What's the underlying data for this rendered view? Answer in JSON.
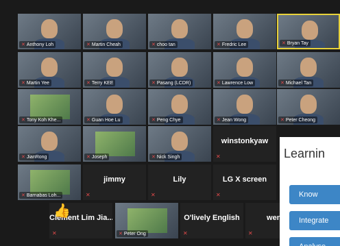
{
  "rows": [
    [
      {
        "name": "Anthony Loh",
        "video": true,
        "active": false
      },
      {
        "name": "Martin Cheah",
        "video": true,
        "active": false
      },
      {
        "name": "choo tan",
        "video": true,
        "active": false
      },
      {
        "name": "Fredric Lee",
        "video": true,
        "active": false
      },
      {
        "name": "Bryan Tay",
        "video": true,
        "active": true
      }
    ],
    [
      {
        "name": "Martin Yee",
        "video": true,
        "active": false
      },
      {
        "name": "Terry KEE",
        "video": true,
        "active": false
      },
      {
        "name": "Pasang (LCDR)",
        "video": true,
        "active": false
      },
      {
        "name": "Lawrence Low",
        "video": true,
        "active": false
      },
      {
        "name": "Michael Tan",
        "video": true,
        "active": false
      }
    ],
    [
      {
        "name": "Tony Koh Khe...",
        "video": true,
        "active": false
      },
      {
        "name": "Guan Hoe Lu",
        "video": true,
        "active": false
      },
      {
        "name": "Peng Chye",
        "video": true,
        "active": false
      },
      {
        "name": "Jean Wong",
        "video": true,
        "active": false
      },
      {
        "name": "Peter Cheong",
        "video": true,
        "active": false
      }
    ],
    [
      {
        "name": "JianRong",
        "video": true,
        "active": false
      },
      {
        "name": "Joseph",
        "video": true,
        "active": false
      },
      {
        "name": "Nick Singh",
        "video": true,
        "active": false
      },
      {
        "name": "winstonkyaw",
        "video": false,
        "active": false
      }
    ],
    [
      {
        "name": "Barnabas Loh...",
        "video": true,
        "active": false
      },
      {
        "name": "jimmy",
        "video": false,
        "active": false
      },
      {
        "name": "Lily",
        "video": false,
        "active": false
      },
      {
        "name": "LG X screen",
        "video": false,
        "active": false
      }
    ],
    [
      {
        "name": "Clement Lim Jia...",
        "video": false,
        "active": false
      },
      {
        "name": "Peter Ong",
        "video": true,
        "active": false
      },
      {
        "name": "O'lively English",
        "video": false,
        "active": false
      },
      {
        "name": "wenw",
        "video": false,
        "active": false
      }
    ]
  ],
  "slide": {
    "title": "Learnin",
    "buttons": [
      "Know",
      "Integrate",
      "Analyse"
    ]
  },
  "colors": {
    "accent": "#e8d23a",
    "muted": "#e24a4a",
    "slide_button": "#3d86c6"
  }
}
